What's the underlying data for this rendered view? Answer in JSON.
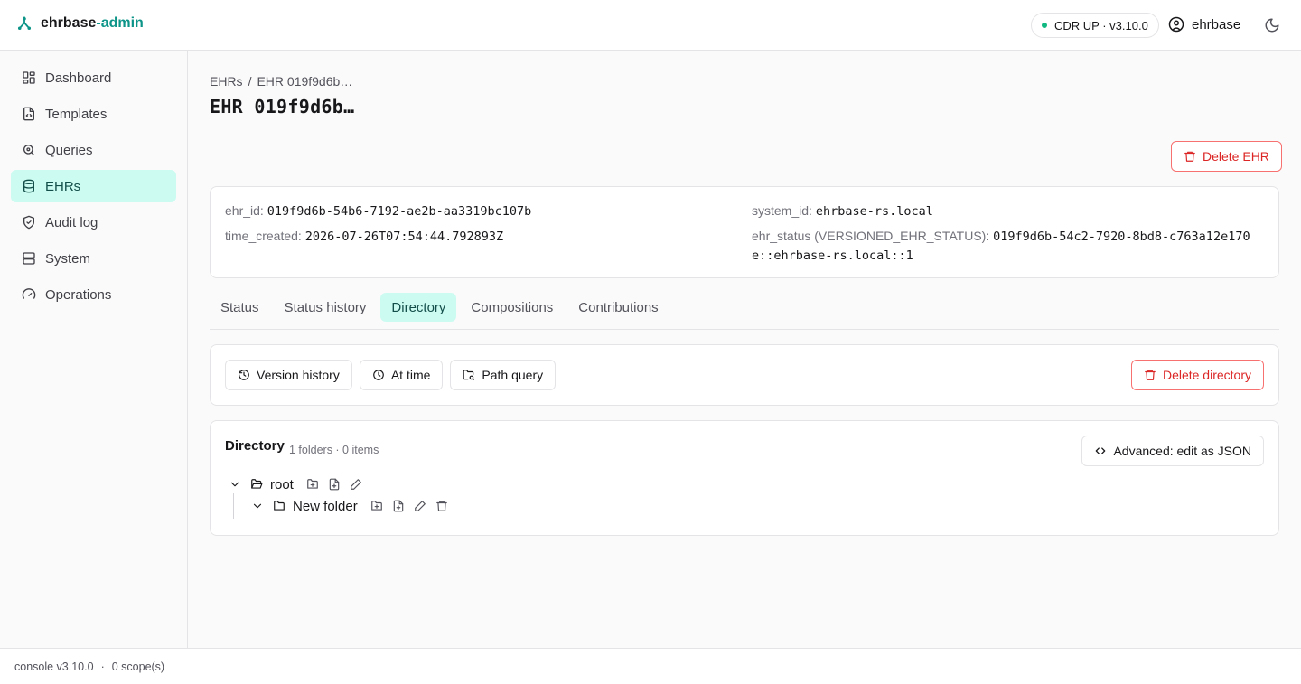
{
  "brand": {
    "name": "ehrbase",
    "suffix": "-admin"
  },
  "header": {
    "status": "CDR UP · v3.10.0",
    "user": "ehrbase",
    "icons": {
      "logo": "network-icon",
      "user": "user-circle-icon",
      "theme": "moon-icon"
    }
  },
  "sidebar": {
    "items": [
      {
        "label": "Dashboard",
        "icon": "dashboard-icon"
      },
      {
        "label": "Templates",
        "icon": "file-code-icon"
      },
      {
        "label": "Queries",
        "icon": "search-icon"
      },
      {
        "label": "EHRs",
        "icon": "database-icon",
        "active": true
      },
      {
        "label": "Audit log",
        "icon": "shield-check-icon"
      },
      {
        "label": "System",
        "icon": "server-icon"
      },
      {
        "label": "Operations",
        "icon": "gauge-icon"
      }
    ]
  },
  "breadcrumb": {
    "root": "EHRs",
    "separator": "/",
    "current": "EHR 019f9d6b…"
  },
  "page": {
    "title": "EHR 019f9d6b…",
    "delete_label": "Delete EHR"
  },
  "info": {
    "ehr_id_label": "ehr_id:",
    "ehr_id": "019f9d6b-54b6-7192-ae2b-aa3319bc107b",
    "system_id_label": "system_id:",
    "system_id": "ehrbase-rs.local",
    "time_created_label": "time_created:",
    "time_created": "2026-07-26T07:54:44.792893Z",
    "ehr_status_label": "ehr_status (VERSIONED_EHR_STATUS):",
    "ehr_status_line1": "019f9d6b-54c2-7920-8bd8-c763a12e170",
    "ehr_status_line2": "e::ehrbase-rs.local::1"
  },
  "tabs": [
    {
      "label": "Status"
    },
    {
      "label": "Status history"
    },
    {
      "label": "Directory",
      "active": true
    },
    {
      "label": "Compositions"
    },
    {
      "label": "Contributions"
    }
  ],
  "actions": {
    "version_history": "Version history",
    "at_time": "At time",
    "path_query": "Path query",
    "delete_directory": "Delete directory"
  },
  "directory": {
    "title": "Directory",
    "meta": "1 folders · 0 items",
    "json_button": "Advanced: edit as JSON",
    "root": "root",
    "child": "New folder"
  },
  "footer": {
    "console": "console v3.10.0",
    "separator": "·",
    "scopes": "0 scope(s)"
  },
  "colors": {
    "accent": "#0d9488",
    "active_bg": "#ccfbf1",
    "danger": "#dc2626",
    "status_ok": "#10b981"
  }
}
